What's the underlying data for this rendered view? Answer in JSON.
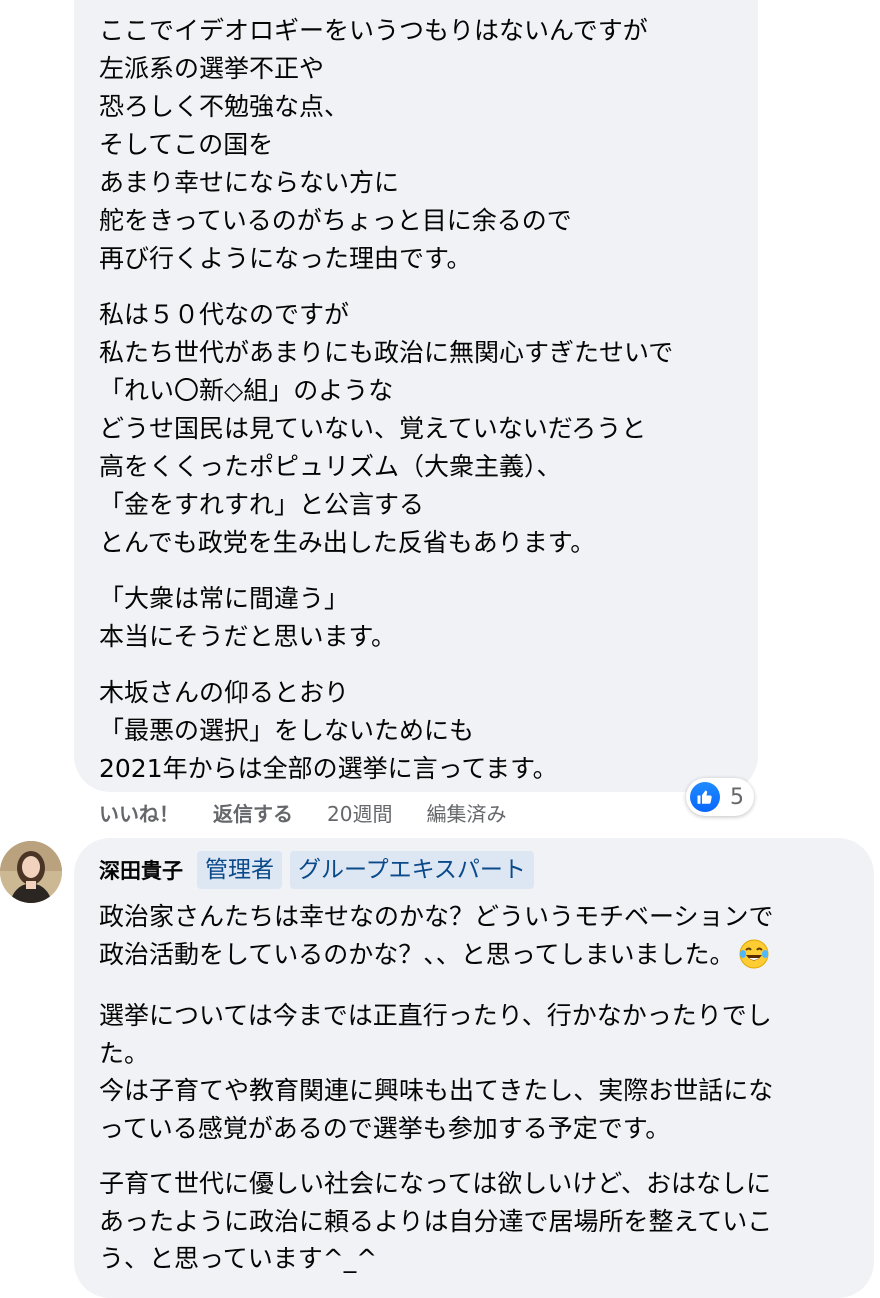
{
  "comment1": {
    "paragraphs": [
      [
        "ここでイデオロギーをいうつもりはないんですが",
        "左派系の選挙不正や",
        "恐ろしく不勉強な点、",
        "そしてこの国を",
        "あまり幸せにならない方に",
        "舵をきっているのがちょっと目に余るので",
        "再び行くようになった理由です。"
      ],
      [
        "私は５０代なのですが",
        "私たち世代があまりにも政治に無関心すぎたせいで",
        "「れい〇新◇組」のような",
        "どうせ国民は見ていない、覚えていないだろうと",
        "高をくくったポピュリズム（大衆主義）、",
        "「金をすれすれ」と公言する",
        "とんでも政党を生み出した反省もあります。"
      ],
      [
        "「大衆は常に間違う」",
        "本当にそうだと思います。"
      ],
      [
        "木坂さんの仰るとおり",
        "「最悪の選択」をしないためにも",
        "2021年からは全部の選挙に言ってます。"
      ]
    ],
    "reaction_count": "5",
    "actions": {
      "like": "いいね！",
      "reply": "返信する",
      "time": "20週間",
      "edited": "編集済み"
    }
  },
  "comment2": {
    "author": "深田貴子",
    "badges": [
      "管理者",
      "グループエキスパート"
    ],
    "paragraphs": [
      [
        "政治家さんたちは幸せなのかな？どういうモチベーションで",
        "政治活動をしているのかな？、、と思ってしまいました。"
      ],
      [
        "選挙については今までは正直行ったり、行かなかったりでし",
        "た。",
        "今は子育てや教育関連に興味も出てきたし、実際お世話にな",
        "っている感覚があるので選挙も参加する予定です。"
      ],
      [
        "子育て世代に優しい社会になっては欲しいけど、おはなしに",
        "あったように政治に頼るよりは自分達で居場所を整えていこ",
        "う、と思っています^_^"
      ]
    ],
    "emoji": "laughing-tears-emoji"
  },
  "colors": {
    "bubble": "#f0f2f5",
    "like_blue": "#0866ff",
    "badge_bg": "#dde6f3",
    "badge_text": "#0a4a8a",
    "meta_text": "#65676b"
  }
}
